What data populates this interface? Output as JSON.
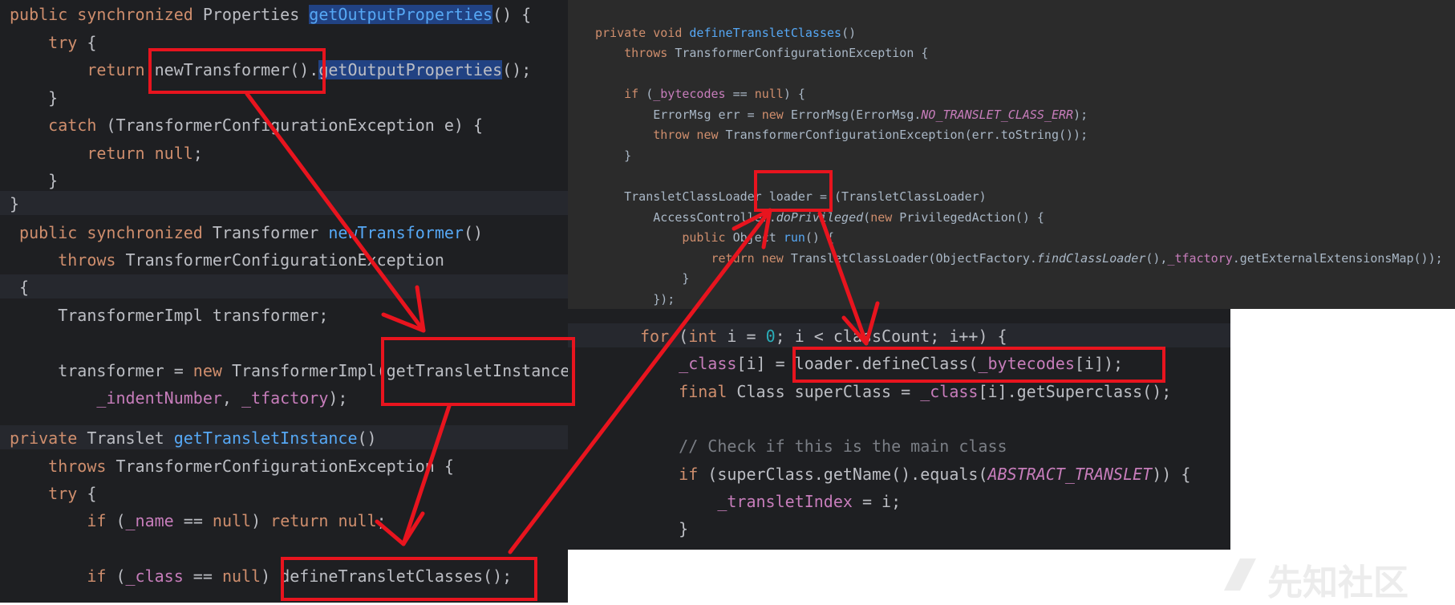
{
  "panel1": {
    "lines": [
      "public synchronized Properties getOutputProperties() {",
      "    try {",
      "        return newTransformer().getOutputProperties();",
      "    }",
      "    catch (TransformerConfigurationException e) {",
      "        return null;",
      "    }",
      "}"
    ]
  },
  "panel2": {
    "lines": [
      "private void defineTransletClasses()",
      "    throws TransformerConfigurationException {",
      "",
      "    if (_bytecodes == null) {",
      "        ErrorMsg err = new ErrorMsg(ErrorMsg.NO_TRANSLET_CLASS_ERR);",
      "        throw new TransformerConfigurationException(err.toString());",
      "    }",
      "",
      "    TransletClassLoader loader = (TransletClassLoader)",
      "        AccessController.doPrivileged(new PrivilegedAction() {",
      "            public Object run() {",
      "                return new TransletClassLoader(ObjectFactory.findClassLoader(),_tfactory.getExternalExtensionsMap());",
      "            }",
      "        });"
    ]
  },
  "panel3": {
    "lines": [
      " public synchronized Transformer newTransformer()",
      "     throws TransformerConfigurationException",
      " {",
      "     TransformerImpl transformer;",
      "",
      "     transformer = new TransformerImpl(getTransletInstance(),",
      "         _indentNumber, _tfactory);",
      "private Translet getTransletInstance()",
      "    throws TransformerConfigurationException {",
      "    try {",
      "        if (_name == null) return null;",
      "",
      "        if (_class == null) defineTransletClasses();"
    ]
  },
  "panel4": {
    "lines": [
      "for (int i = 0; i < classCount; i++) {",
      "    _class[i] = loader.defineClass(_bytecodes[i]);",
      "    final Class superClass = _class[i].getSuperclass();",
      "",
      "    // Check if this is the main class",
      "    if (superClass.getName().equals(ABSTRACT_TRANSLET)) {",
      "        _transletIndex = i;",
      "    }"
    ]
  },
  "watermark": {
    "text": "先知社区"
  },
  "colors": {
    "editor_bg": "#1e1f22",
    "keyword": "#cf8e6d",
    "method": "#56a8f5",
    "field": "#c77dbb",
    "number": "#2aacb8",
    "comment": "#7a7e85",
    "annotation": "#e8141e"
  }
}
